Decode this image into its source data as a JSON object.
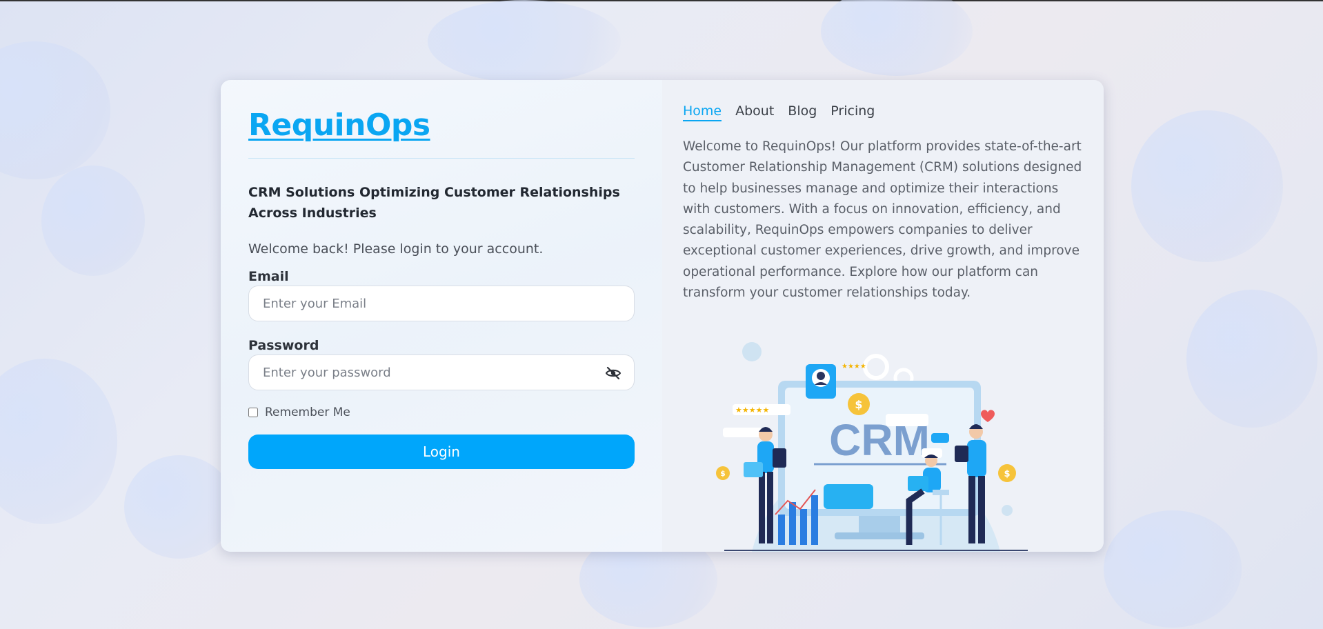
{
  "brand": {
    "name": "RequinOps"
  },
  "login": {
    "tagline": "CRM Solutions Optimizing Customer Relationships Across Industries",
    "welcome": "Welcome back! Please login to your account.",
    "email_label": "Email",
    "email_placeholder": "Enter your Email",
    "password_label": "Password",
    "password_placeholder": "Enter your password",
    "remember_label": "Remember Me",
    "remember_checked": false,
    "button_label": "Login"
  },
  "nav": {
    "items": [
      {
        "label": "Home",
        "active": true
      },
      {
        "label": "About",
        "active": false
      },
      {
        "label": "Blog",
        "active": false
      },
      {
        "label": "Pricing",
        "active": false
      }
    ]
  },
  "about": {
    "text": "Welcome to RequinOps! Our platform provides state-of-the-art Customer Relationship Management (CRM) solutions designed to help businesses manage and optimize their interactions with customers. With a focus on innovation, efficiency, and scalability, RequinOps empowers companies to deliver exceptional customer experiences, drive growth, and improve operational performance. Explore how our platform can transform your customer relationships today."
  },
  "illustration": {
    "monitor_text": "CRM",
    "rating_stars": "★★★★★",
    "small_stars": "★★★★",
    "coin_symbol": "$"
  },
  "colors": {
    "accent": "#00a6fb",
    "brand": "#0aa6f2",
    "text_dark": "#222831",
    "text_muted": "#5a5f68"
  },
  "icons": {
    "password_toggle": "eye-slash-icon"
  }
}
